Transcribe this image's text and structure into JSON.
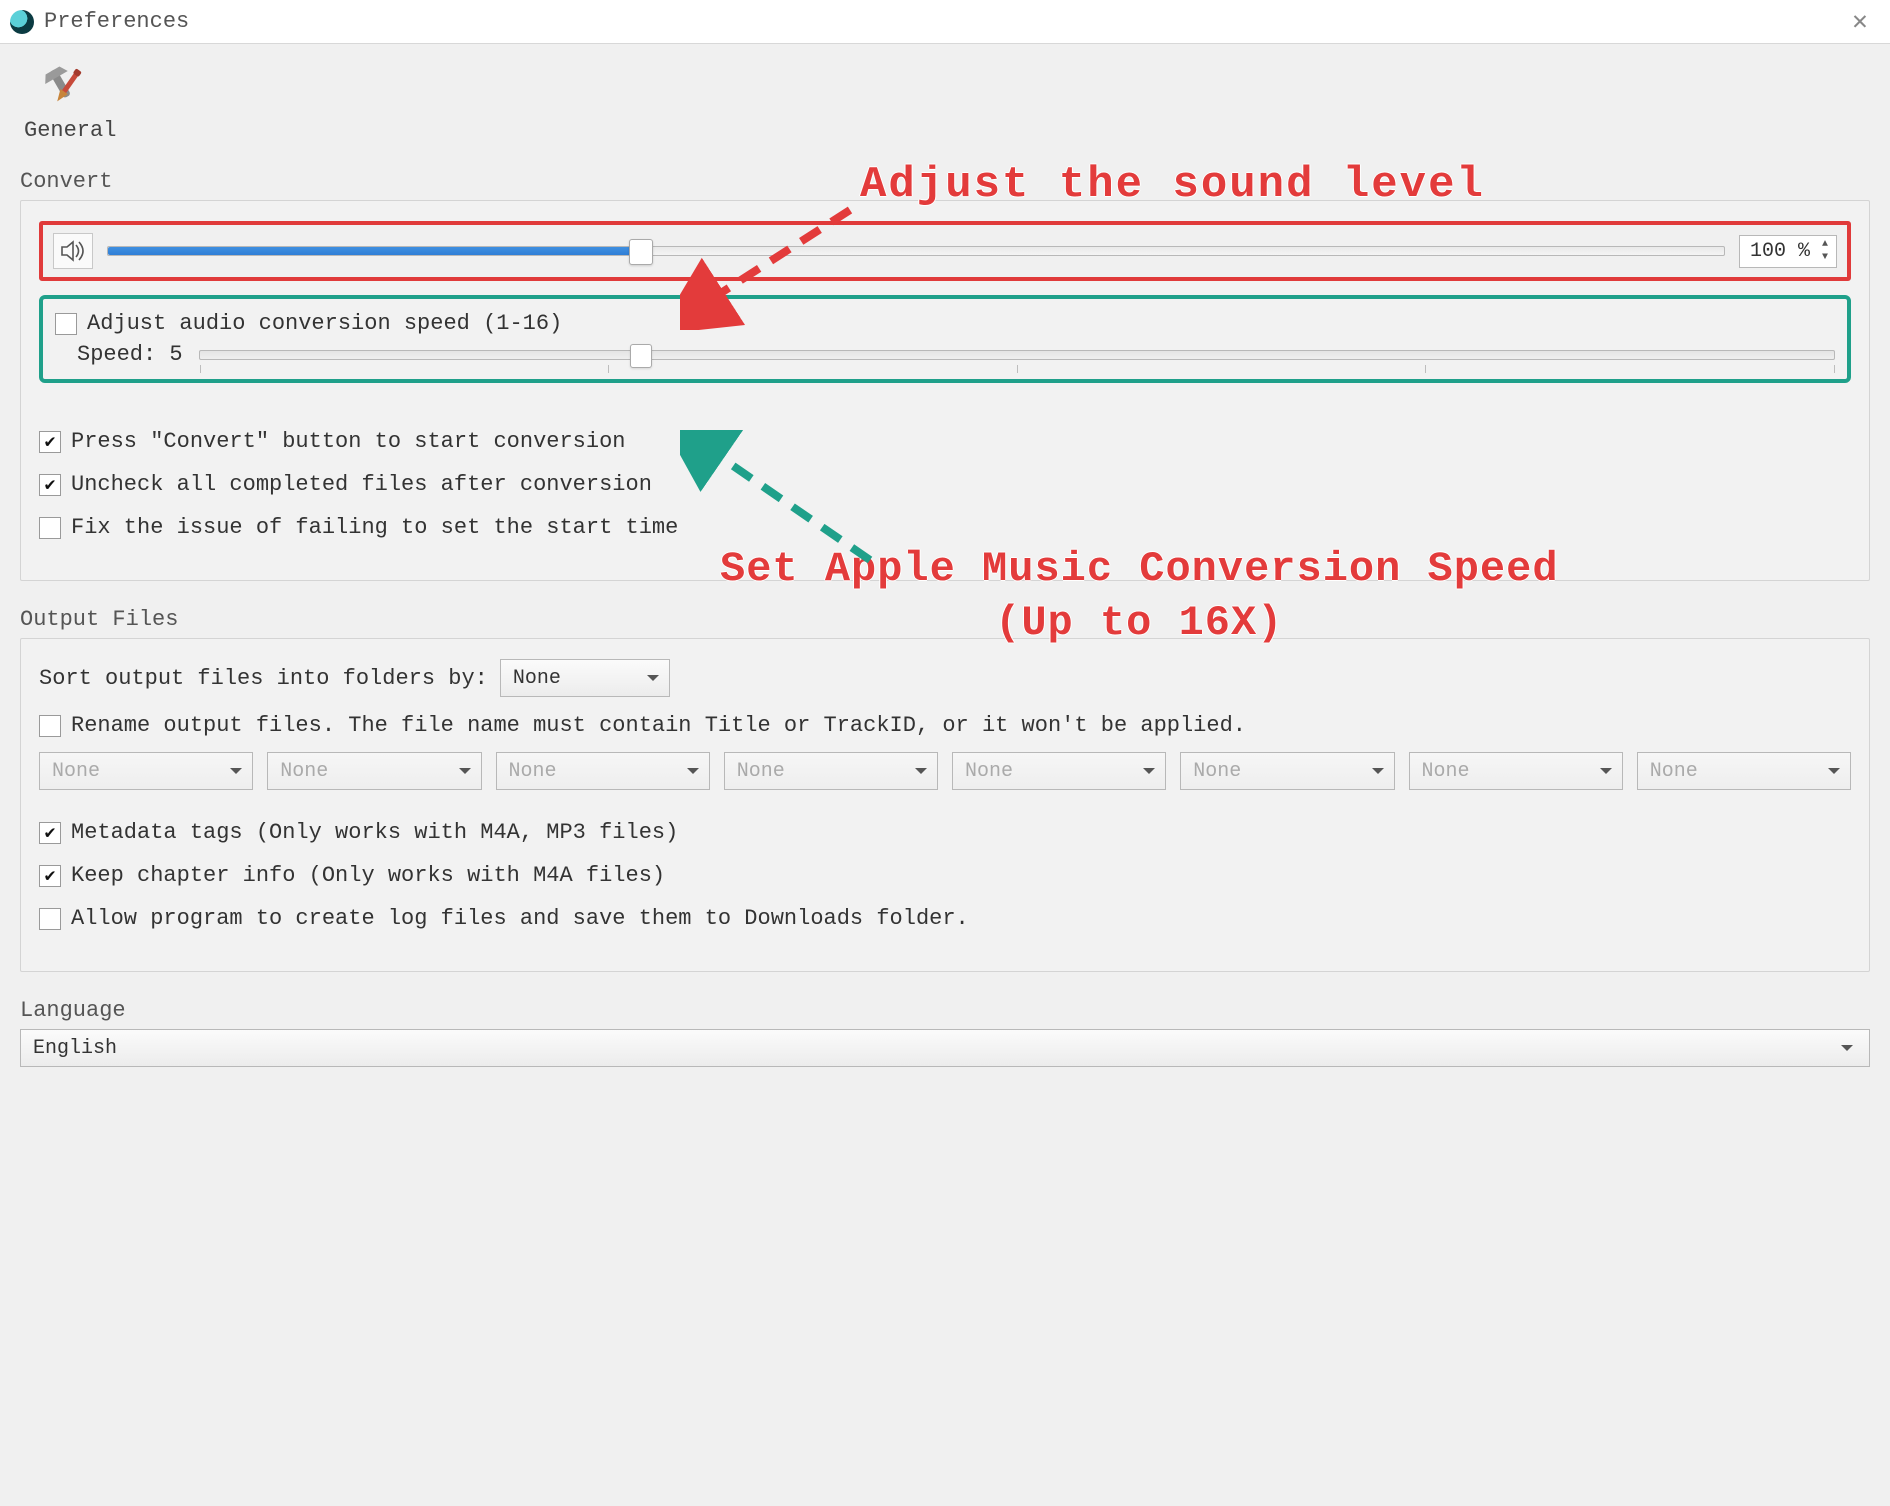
{
  "window": {
    "title": "Preferences"
  },
  "tab": {
    "general": "General"
  },
  "convert": {
    "section": "Convert",
    "volume_pct": "100 %",
    "volume_fill_pct": 33,
    "adjust_speed_label": "Adjust audio conversion speed (1-16)",
    "adjust_speed_checked": false,
    "speed_label": "Speed: 5",
    "speed_thumb_pct": 27,
    "press_convert": {
      "checked": true,
      "label": "Press \"Convert\" button to start conversion"
    },
    "uncheck_completed": {
      "checked": true,
      "label": "Uncheck all completed files after conversion"
    },
    "fix_start_time": {
      "checked": false,
      "label": "Fix the issue of failing to set the start time"
    }
  },
  "output": {
    "section": "Output Files",
    "sort_label": "Sort output files into folders by:",
    "sort_value": "None",
    "rename": {
      "checked": false,
      "label": "Rename output files. The file name must contain Title or TrackID, or it won't be applied."
    },
    "rename_fields": [
      "None",
      "None",
      "None",
      "None",
      "None",
      "None",
      "None",
      "None"
    ],
    "metadata": {
      "checked": true,
      "label": "Metadata tags (Only works with M4A, MP3 files)"
    },
    "chapter": {
      "checked": true,
      "label": "Keep chapter info (Only works with M4A files)"
    },
    "logfiles": {
      "checked": false,
      "label": "Allow program to create log files and save them to Downloads folder."
    }
  },
  "language": {
    "section": "Language",
    "value": "English"
  },
  "annotations": {
    "a1": "Adjust the sound level",
    "a2_line1": "Set Apple Music Conversion Speed",
    "a2_line2": "(Up to 16X)"
  },
  "colors": {
    "highlight_red": "#e03a3a",
    "highlight_green": "#1fa08a",
    "slider_blue": "#2f7ed6",
    "anno_red": "#e33b3b"
  }
}
